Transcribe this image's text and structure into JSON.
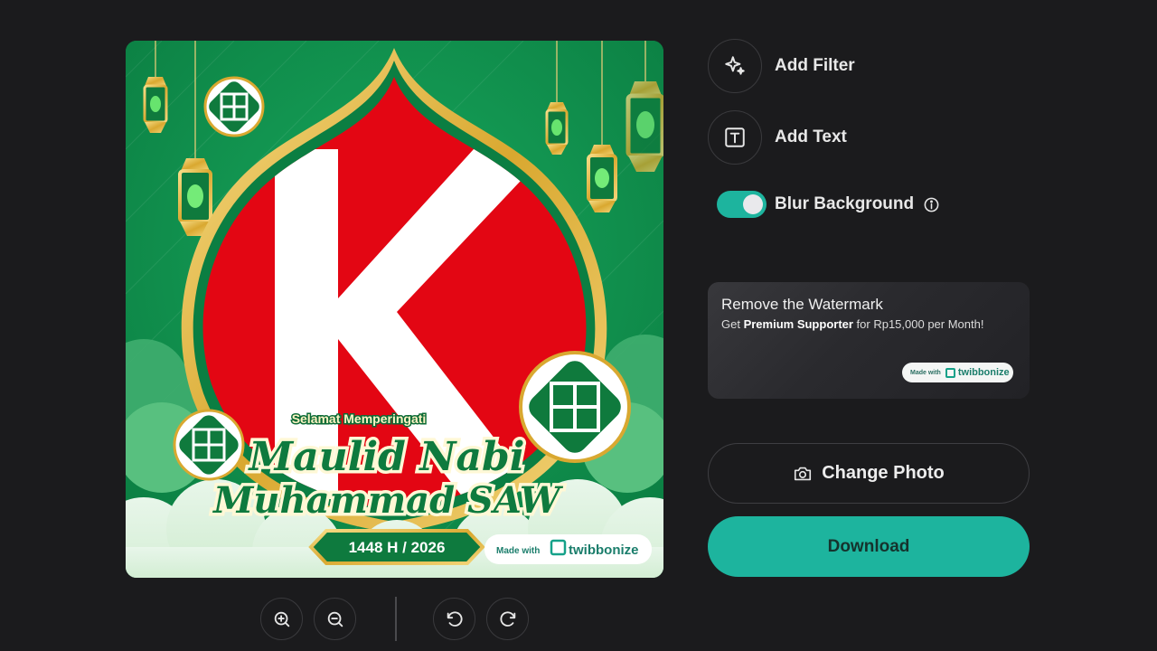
{
  "preview": {
    "subtitle": "Selamat Memperingati",
    "title_line1": "Maulid Nabi",
    "title_line2": "Muhammad SAW",
    "year": "1448 H / 2026",
    "photo_letter": "K",
    "badge_small": "Made with",
    "badge_brand": "twibbonize"
  },
  "toolbar": {
    "zoom_in_icon": "zoom-in-icon",
    "zoom_out_icon": "zoom-out-icon",
    "rotate_left_icon": "rotate-left-icon",
    "rotate_right_icon": "rotate-right-icon"
  },
  "options": {
    "add_filter": "Add Filter",
    "add_text": "Add Text",
    "blur_background": "Blur Background",
    "blur_enabled": true
  },
  "promo": {
    "title": "Remove the Watermark",
    "sub_prefix": "Get ",
    "sub_bold": "Premium Supporter",
    "sub_suffix": " for Rp15,000 per Month!",
    "badge_small": "Made with",
    "badge_brand": "twibbonize"
  },
  "actions": {
    "change_photo": "Change Photo",
    "download": "Download"
  },
  "colors": {
    "accent": "#1db49e",
    "background": "#1b1b1d",
    "frame_green": "#0f8f4d",
    "photo_red": "#e30613",
    "gold": "#d9a830"
  }
}
